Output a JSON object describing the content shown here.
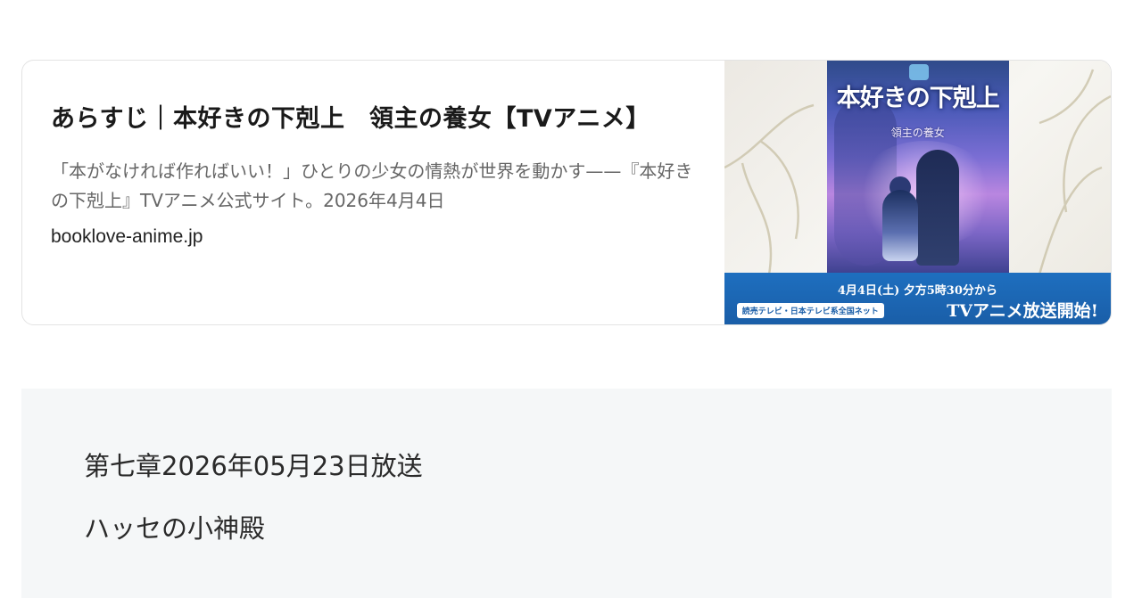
{
  "link_card": {
    "title": "あらすじ｜本好きの下剋上　領主の養女【TVアニメ】",
    "description": "「本がなければ作ればいい！」ひとりの少女の情熱が世界を動かす——『本好きの下剋上』TVアニメ公式サイト。2026年4月4日",
    "domain": "booklove-anime.jp",
    "thumbnail": {
      "poster_title": "本好きの下剋上",
      "poster_subtitle": "領主の養女",
      "banner_date": "4月4日(土) 夕方5時30分から",
      "banner_network": "読売テレビ・日本テレビ系全国ネット",
      "banner_start": "TVアニメ放送開始!"
    }
  },
  "episode": {
    "broadcast": "第七章2026年05月23日放送",
    "title": "ハッセの小神殿"
  },
  "colors": {
    "card_border": "#e3e3e3",
    "content_bg": "#f5f7f8",
    "banner_blue": "#1a5ea8"
  }
}
